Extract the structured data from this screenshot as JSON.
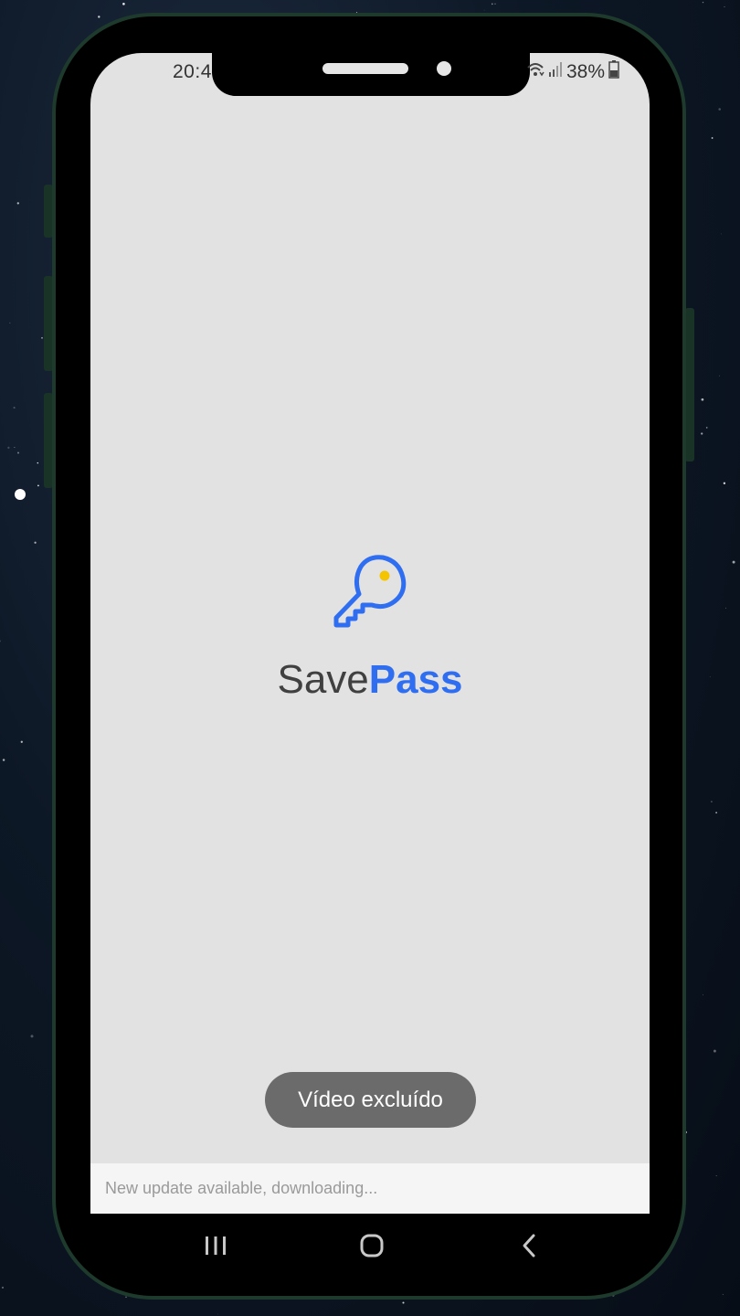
{
  "status_bar": {
    "time": "20:4",
    "battery": "38%",
    "icons": [
      "wifi-icon",
      "signal-icon",
      "battery-icon"
    ]
  },
  "app": {
    "name_part1": "Save",
    "name_part2": "Pass",
    "logo_icon": "key-icon",
    "brand_color": "#2f6ef0",
    "accent_color": "#f5c400"
  },
  "toast": {
    "text": "Vídeo excluído"
  },
  "update_bar": {
    "text": "New update available, downloading..."
  },
  "nav_bar": {
    "buttons": [
      "recents-icon",
      "home-icon",
      "back-icon"
    ]
  }
}
